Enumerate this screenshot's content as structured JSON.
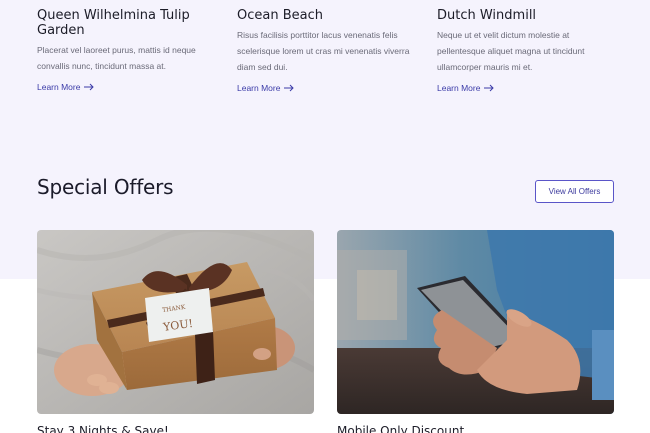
{
  "attractions": [
    {
      "title": "Queen Wilhelmina Tulip Garden",
      "desc": "Placerat vel laoreet purus, mattis id neque convallis nunc, tincidunt massa at.",
      "link": "Learn More"
    },
    {
      "title": "Ocean Beach",
      "desc": "Risus facilisis porttitor lacus venenatis felis scelerisque lorem ut cras mi venenatis viverra diam sed dui.",
      "link": "Learn More"
    },
    {
      "title": "Dutch Windmill",
      "desc": "Neque ut et velit dictum molestie at pellentesque aliquet magna ut tincidunt ullamcorper mauris mi et.",
      "link": "Learn More"
    }
  ],
  "special_offers": {
    "title": "Special Offers",
    "view_all_label": "View All Offers",
    "offers": [
      {
        "title": "Stay 3 Nights & Save!",
        "image": "gift-box-photo",
        "tag_line1": "THANK",
        "tag_line2": "YOU!"
      },
      {
        "title": "Mobile Only Discount",
        "image": "smartphone-hands-photo"
      }
    ]
  },
  "colors": {
    "accent": "#3b3ba8",
    "lavender_bg": "#f5f3fd"
  }
}
